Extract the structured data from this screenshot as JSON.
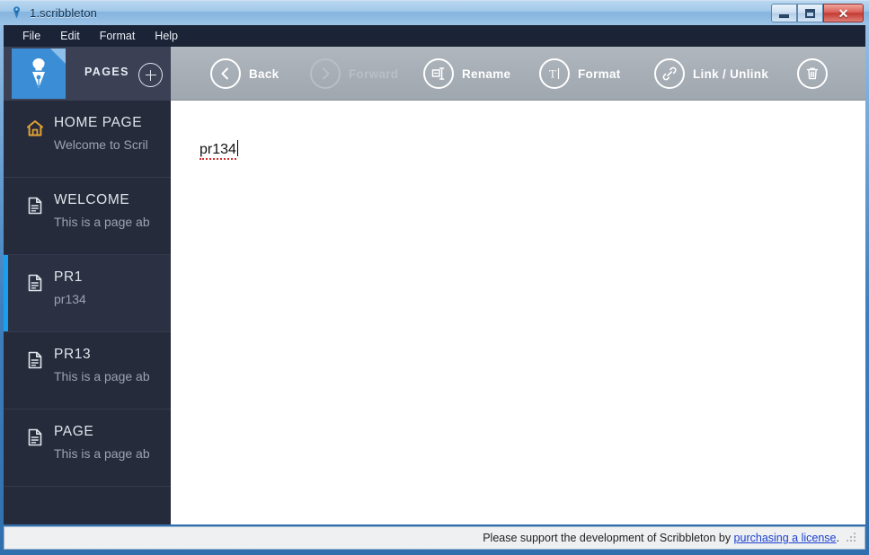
{
  "window": {
    "title": "1.scribbleton",
    "app_icon": "pen-nib-icon",
    "controls": {
      "minimize": "minimize-button",
      "maximize": "maximize-button",
      "close": "close-button"
    }
  },
  "menubar": {
    "items": [
      {
        "label": "File"
      },
      {
        "label": "Edit"
      },
      {
        "label": "Format"
      },
      {
        "label": "Help"
      }
    ]
  },
  "sidebar": {
    "header": {
      "label": "PAGES",
      "add_button": "add-page-button",
      "logo": "scribbleton-logo"
    },
    "items": [
      {
        "title": "HOME PAGE",
        "subtitle": "Welcome to Scril",
        "icon": "home-icon",
        "selected": false
      },
      {
        "title": "WELCOME",
        "subtitle": "This is a page ab",
        "icon": "document-icon",
        "selected": false
      },
      {
        "title": "PR1",
        "subtitle": "pr134",
        "icon": "document-icon",
        "selected": true
      },
      {
        "title": "PR13",
        "subtitle": "This is a page ab",
        "icon": "document-icon",
        "selected": false
      },
      {
        "title": "PAGE",
        "subtitle": "This is a page ab",
        "icon": "document-icon",
        "selected": false
      }
    ]
  },
  "toolbar": {
    "back_label": "Back",
    "forward_label": "Forward",
    "rename_label": "Rename",
    "format_label": "Format",
    "link_label": "Link / Unlink",
    "delete_label": ""
  },
  "editor": {
    "text": "pr134"
  },
  "statusbar": {
    "message": "Please support the development of Scribbleton by ",
    "link": "purchasing a license",
    "suffix": "."
  },
  "colors": {
    "accent_blue": "#1a9ff0",
    "sidebar_bg": "#262b3b",
    "toolbar_bg": "#a7aeb6",
    "home_icon": "#e0a134",
    "link": "#1a3fd0"
  }
}
